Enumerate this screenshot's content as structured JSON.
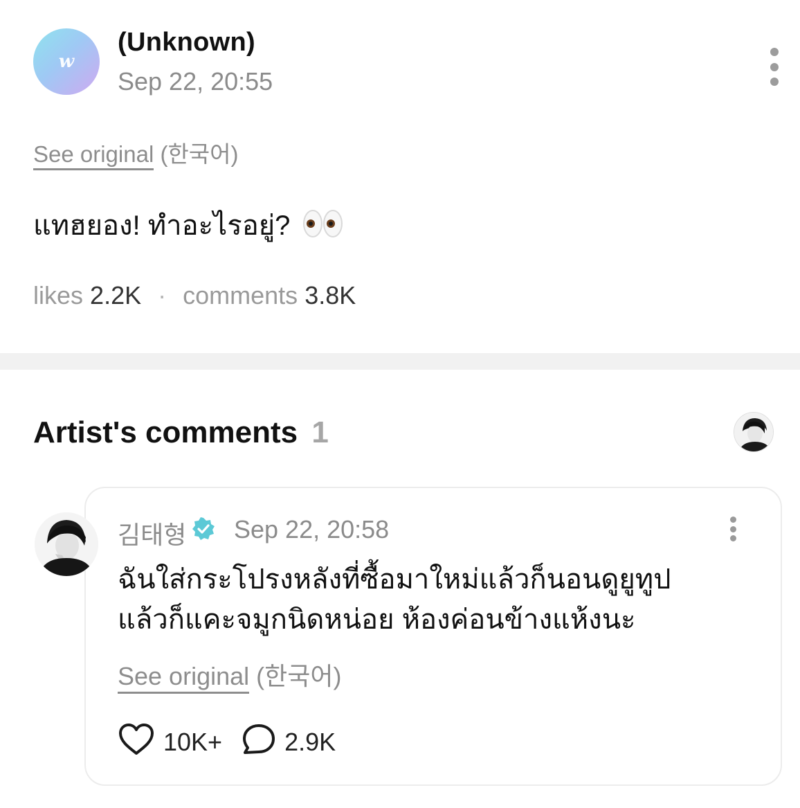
{
  "post": {
    "avatar_letter": "w",
    "author": "(Unknown)",
    "timestamp": "Sep 22, 20:55",
    "see_original": "See original",
    "original_lang": "(한국어)",
    "text": "แทฮยอง! ทำอะไรอยู่?",
    "emoji_icon": "eyes-emoji",
    "likes_label": "likes",
    "likes_count": "2.2K",
    "separator": "·",
    "comments_label": "comments",
    "comments_count": "3.8K"
  },
  "artist_comments": {
    "title": "Artist's comments",
    "count": "1"
  },
  "comment": {
    "author": "김태형",
    "verified_icon": "verified-badge-icon",
    "timestamp": "Sep 22, 20:58",
    "text_line1": "ฉันใส่กระโปรงหลังที่ซื้อมาใหม่แล้วก็นอนดูยูทูป",
    "text_line2": "แล้วก็แคะจมูกนิดหน่อย ห้องค่อนข้างแห้งนะ",
    "see_original": "See original",
    "original_lang": "(한국어)",
    "likes_count": "10K+",
    "replies_count": "2.9K"
  },
  "colors": {
    "text": "#111111",
    "muted": "#8b8b8b",
    "divider": "#f1f1f1",
    "badge": "#5cc9d6",
    "card_border": "#ececec"
  }
}
